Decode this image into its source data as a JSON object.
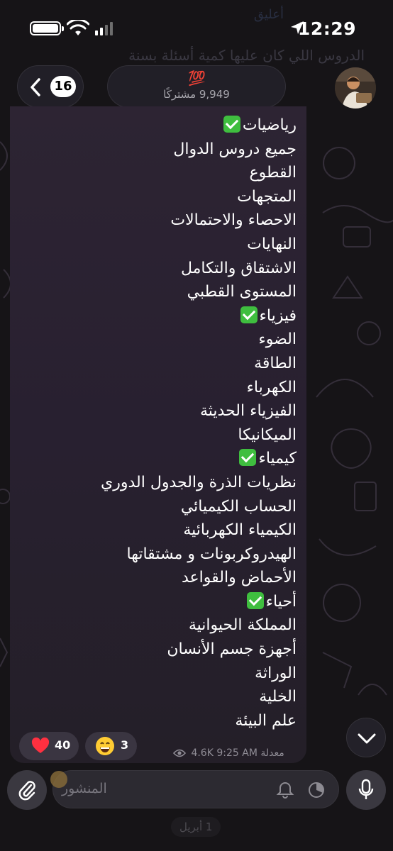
{
  "status_bar": {
    "time": "12:29"
  },
  "ghost_header": {
    "name": "أعليق",
    "preview": "الدروس اللي كان عليها كمية أسئلة بسنة"
  },
  "header": {
    "unread_count": "16",
    "channel_title": "💯",
    "subscribers": "9,949 مشتركًا"
  },
  "message": {
    "lines": [
      {
        "text": "رياضيات",
        "check": true
      },
      {
        "text": "جميع دروس الدوال",
        "check": false
      },
      {
        "text": "القطوع",
        "check": false
      },
      {
        "text": "المتجهات",
        "check": false
      },
      {
        "text": "الاحصاء والاحتمالات",
        "check": false
      },
      {
        "text": "النهايات",
        "check": false
      },
      {
        "text": "الاشتقاق والتكامل",
        "check": false
      },
      {
        "text": "المستوى القطبي",
        "check": false
      },
      {
        "text": "فيزياء",
        "check": true
      },
      {
        "text": "الضوء",
        "check": false
      },
      {
        "text": "الطاقة",
        "check": false
      },
      {
        "text": "الكهرباء",
        "check": false
      },
      {
        "text": "الفيزياء الحديثة",
        "check": false
      },
      {
        "text": "الميكانيكا",
        "check": false
      },
      {
        "text": "كيمياء",
        "check": true
      },
      {
        "text": "نظريات الذرة والجدول الدوري",
        "check": false
      },
      {
        "text": "الحساب الكيميائي",
        "check": false
      },
      {
        "text": "الكيمياء الكهربائية",
        "check": false
      },
      {
        "text": "الهيدروكربونات و مشتقاتها",
        "check": false
      },
      {
        "text": "الأحماض والقواعد",
        "check": false
      },
      {
        "text": "أحياء",
        "check": true
      },
      {
        "text": "المملكة الحيوانية",
        "check": false
      },
      {
        "text": "أجهزة جسم الأنسان",
        "check": false
      },
      {
        "text": "الوراثة",
        "check": false
      },
      {
        "text": "الخلية",
        "check": false
      },
      {
        "text": "علم البيئة",
        "check": false
      }
    ],
    "reactions": [
      {
        "emoji": "heart-icon",
        "count": "40"
      },
      {
        "emoji": "grinning-face-icon",
        "count": "3"
      }
    ],
    "edited_label": "معدلة",
    "time": "9:25 AM",
    "views": "4.6K"
  },
  "composer": {
    "placeholder": "المنشور"
  },
  "date_divider": "1 أبريل",
  "colors": {
    "accent_green": "#3fbe3f",
    "heart": "#ff3040",
    "bubble": "#2a2230"
  }
}
